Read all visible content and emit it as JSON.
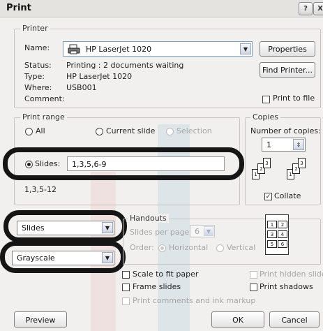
{
  "window": {
    "title": "Print",
    "help_glyph": "?",
    "close_glyph": "X"
  },
  "printer": {
    "group_label": "Printer",
    "name_label": "Name:",
    "name_value": "HP LaserJet 1020",
    "properties_label": "Properties",
    "status_label": "Status:",
    "status_value": "Printing : 2 documents waiting",
    "type_label": "Type:",
    "type_value": "HP LaserJet 1020",
    "where_label": "Where:",
    "where_value": "USB001",
    "comment_label": "Comment:",
    "find_printer_label": "Find Printer...",
    "print_to_file_label": "Print to file"
  },
  "print_range": {
    "group_label": "Print range",
    "all_label": "All",
    "current_slide_label": "Current slide",
    "selection_label": "Selection",
    "slides_label": "Slides:",
    "slides_value": "1,3,5,6-9",
    "hint_text": "1,3,5-12"
  },
  "copies": {
    "group_label": "Copies",
    "number_label": "Number of copies:",
    "number_value": "1",
    "collate_label": "Collate",
    "collate_checked": true
  },
  "print_what": {
    "value": "Slides"
  },
  "color": {
    "value": "Grayscale"
  },
  "handouts": {
    "group_label": "Handouts",
    "slides_per_page_label": "Slides per page:",
    "slides_per_page_value": "6",
    "order_label": "Order:",
    "horizontal_label": "Horizontal",
    "vertical_label": "Vertical",
    "preview_numbers": [
      "1",
      "2",
      "3",
      "4",
      "5",
      "6"
    ]
  },
  "options": {
    "scale_to_fit_label": "Scale to fit paper",
    "frame_slides_label": "Frame slides",
    "comments_label": "Print comments and ink markup",
    "print_hidden_label": "Print hidden slides",
    "print_shadows_label": "Print shadows"
  },
  "buttons": {
    "preview": "Preview",
    "ok": "OK",
    "cancel": "Cancel"
  },
  "collate_pages": [
    "1",
    "2",
    "3",
    "1",
    "2",
    "3"
  ]
}
